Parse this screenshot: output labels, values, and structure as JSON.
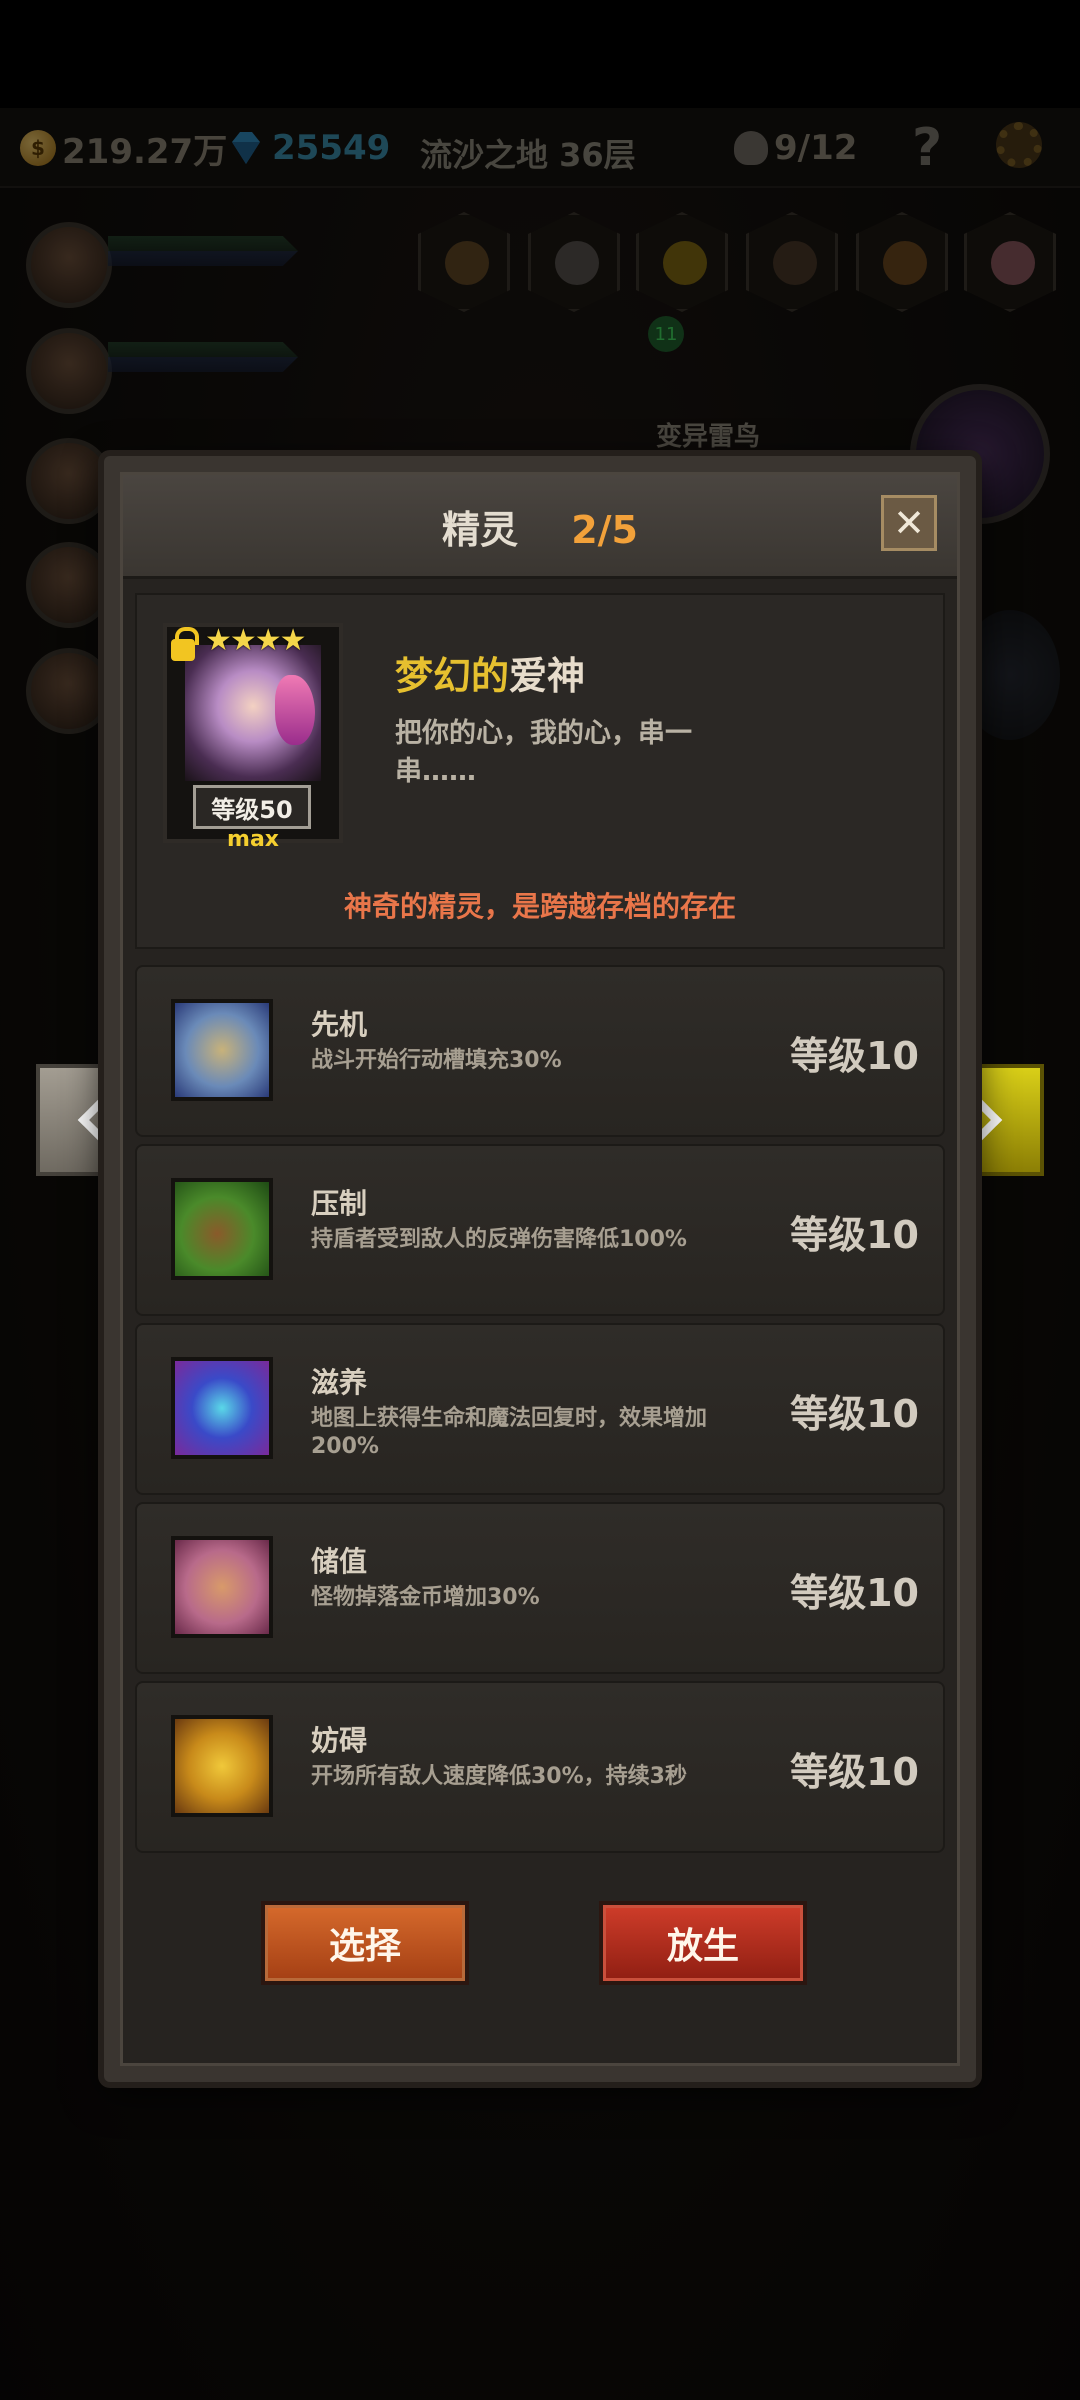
{
  "hud": {
    "gold": "219.27万",
    "coin_glyph": "$",
    "diamonds": "25549",
    "location": "流沙之地 36层",
    "kills": "9/12",
    "help": "?"
  },
  "background": {
    "item_badge": "11",
    "enemy_label": "变异雷鸟"
  },
  "panel": {
    "title": "精灵",
    "page": "2/5",
    "close": "✕"
  },
  "pet": {
    "stars": "★★★★",
    "level": "等级50",
    "max": "max",
    "name_part1": "梦幻的",
    "name_part2": "爱神",
    "description": "把你的心，我的心，串一串……",
    "note": "神奇的精灵，是跨越存档的存在"
  },
  "skills": [
    {
      "name": "先机",
      "description": "战斗开始行动槽填充30%",
      "level": "等级10",
      "icon": "leopard-icon"
    },
    {
      "name": "压制",
      "description": "持盾者受到敌人的反弹伤害降低100%",
      "level": "等级10",
      "icon": "claw-icon"
    },
    {
      "name": "滋养",
      "description": "地图上获得生命和魔法回复时，效果增加200%",
      "level": "等级10",
      "icon": "fairy-icon"
    },
    {
      "name": "储值",
      "description": "怪物掉落金币增加30%",
      "level": "等级10",
      "icon": "goblet-icon"
    },
    {
      "name": "妨碍",
      "description": "开场所有敌人速度降低30%，持续3秒",
      "level": "等级10",
      "icon": "chained-boot-icon"
    }
  ],
  "buttons": {
    "select": "选择",
    "release": "放生"
  },
  "colors": {
    "accent_gold": "#e6c02f",
    "page_orange": "#f2a13a",
    "note_orange": "#e9764a",
    "select_button": "#c05424",
    "release_button": "#b42e1e",
    "nav_right_yellow": "#c8bc10"
  }
}
